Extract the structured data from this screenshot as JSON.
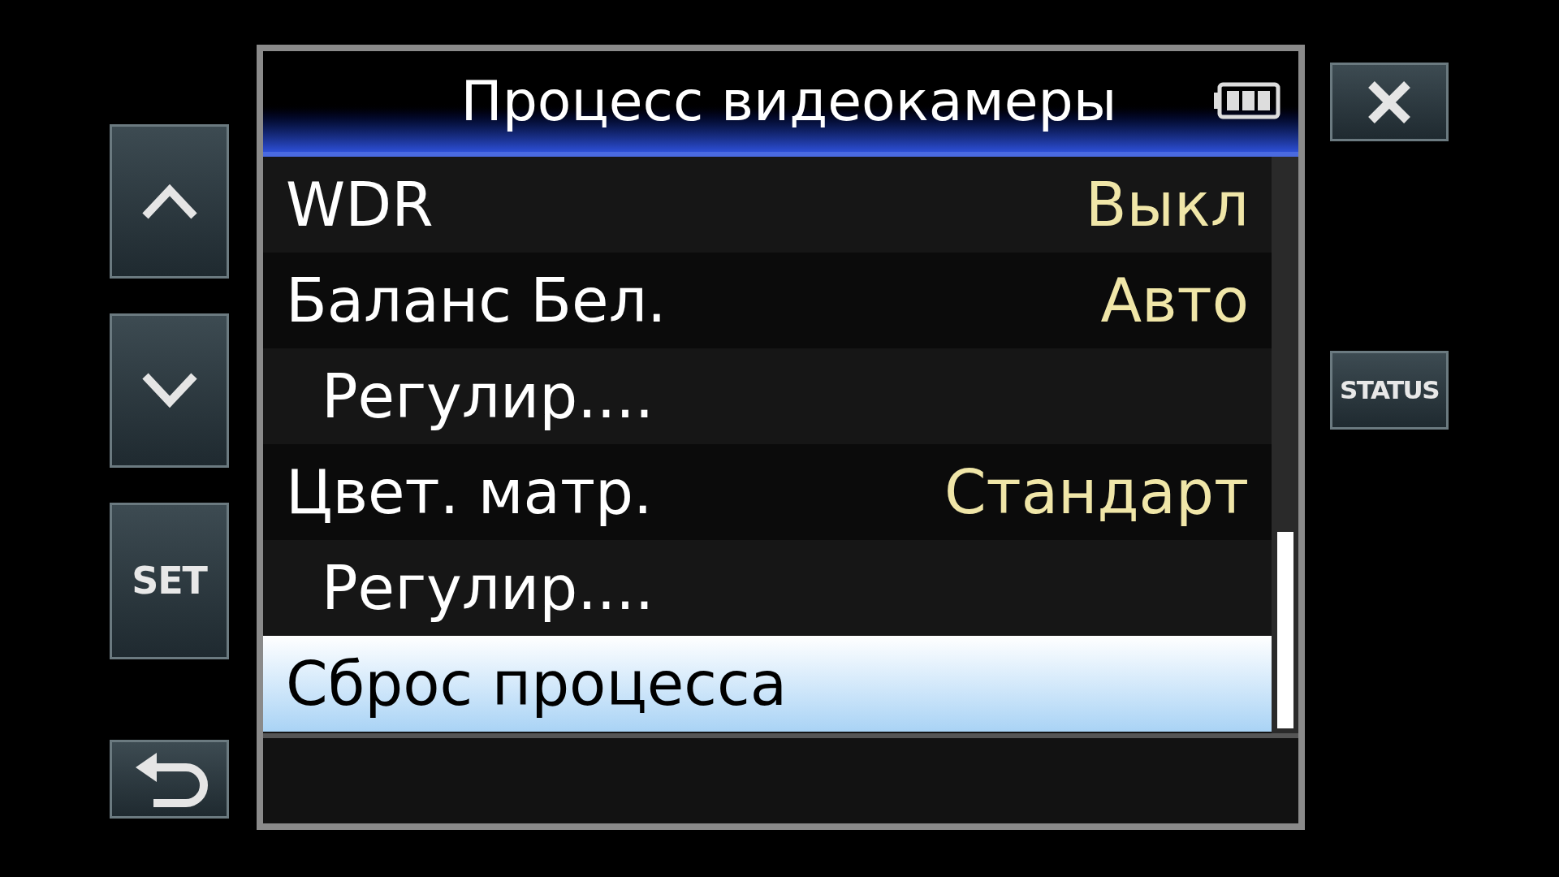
{
  "title": "Процесс видеокамеры",
  "left_buttons": [
    {
      "kind": "up"
    },
    {
      "kind": "down"
    },
    {
      "kind": "text",
      "label": "SET"
    },
    {
      "kind": "back"
    }
  ],
  "right_buttons": [
    {
      "kind": "close"
    },
    {
      "kind": "text",
      "label": "STATUS"
    }
  ],
  "menu": {
    "items": [
      {
        "label": "WDR",
        "value": "Выкл",
        "selected": false
      },
      {
        "label": "Баланс Бел.",
        "value": "Авто",
        "selected": false,
        "children": [
          {
            "label": "Регулир....",
            "selected": false
          }
        ]
      },
      {
        "label": "Цвет. матр.",
        "value": "Стандарт",
        "selected": false,
        "children": [
          {
            "label": "Регулир....",
            "selected": false
          }
        ]
      },
      {
        "label": "Сброс процесса",
        "selected": true
      }
    ]
  }
}
